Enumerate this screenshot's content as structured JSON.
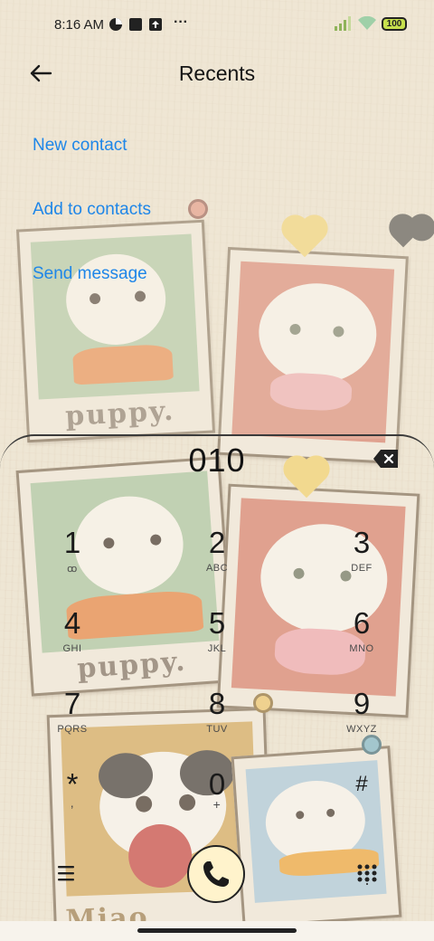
{
  "status_bar": {
    "time": "8:16 AM",
    "battery": "100",
    "more_indicator": "···"
  },
  "header": {
    "title": "Recents",
    "back_icon": "arrow-left-icon"
  },
  "menu": {
    "items": [
      {
        "label": "New contact"
      },
      {
        "label": "Add to contacts"
      },
      {
        "label": "Send message"
      }
    ]
  },
  "dialer": {
    "number": "010",
    "keys": [
      {
        "digit": "1",
        "letters": "ꝏ"
      },
      {
        "digit": "2",
        "letters": "ABC"
      },
      {
        "digit": "3",
        "letters": "DEF"
      },
      {
        "digit": "4",
        "letters": "GHI"
      },
      {
        "digit": "5",
        "letters": "JKL"
      },
      {
        "digit": "6",
        "letters": "MNO"
      },
      {
        "digit": "7",
        "letters": "PQRS"
      },
      {
        "digit": "8",
        "letters": "TUV"
      },
      {
        "digit": "9",
        "letters": "WXYZ"
      },
      {
        "digit": "*",
        "letters": ","
      },
      {
        "digit": "0",
        "letters": "+"
      },
      {
        "digit": "#",
        "letters": ""
      }
    ]
  },
  "wallpaper": {
    "captions": [
      "puppy.",
      "puppy.",
      "Miao"
    ]
  },
  "colors": {
    "link": "#1e86e8",
    "call_button": "#fff3cc",
    "background": "#efe6d4"
  }
}
